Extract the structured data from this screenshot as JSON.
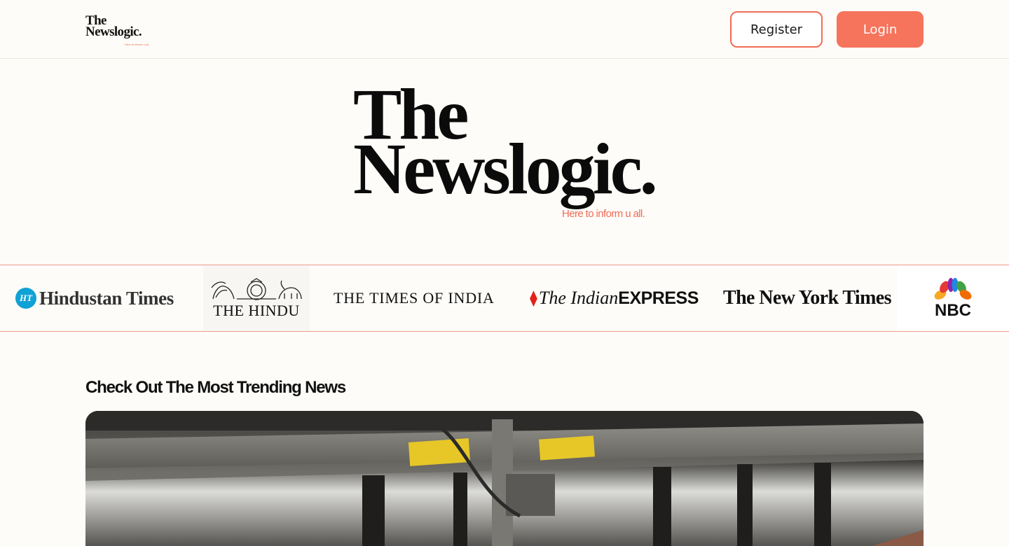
{
  "header": {
    "logo_line1": "The",
    "logo_line2": "Newslogic.",
    "logo_tagline": "Here to inform u all.",
    "register_label": "Register",
    "login_label": "Login"
  },
  "hero": {
    "line1": "The",
    "line2": "Newslogic.",
    "tagline": "Here to inform u all."
  },
  "publishers": [
    {
      "badge": "HT",
      "name": "Hindustan Times",
      "icon": "ht-badge-icon"
    },
    {
      "name": "THE HINDU",
      "icon": "hindu-emblem-icon"
    },
    {
      "name": "THE TIMES OF INDIA"
    },
    {
      "prefix": "The Indian",
      "suffix": "EXPRESS",
      "icon": "express-mark-icon"
    },
    {
      "name": "The New York Times"
    },
    {
      "name": "NBC",
      "icon": "nbc-peacock-icon"
    }
  ],
  "trending": {
    "title": "Check Out The Most Trending News",
    "image_icon": "printing-press-image"
  },
  "colors": {
    "accent": "#f6735c",
    "accent_border": "#f26b56",
    "background": "#fdfcf8"
  }
}
